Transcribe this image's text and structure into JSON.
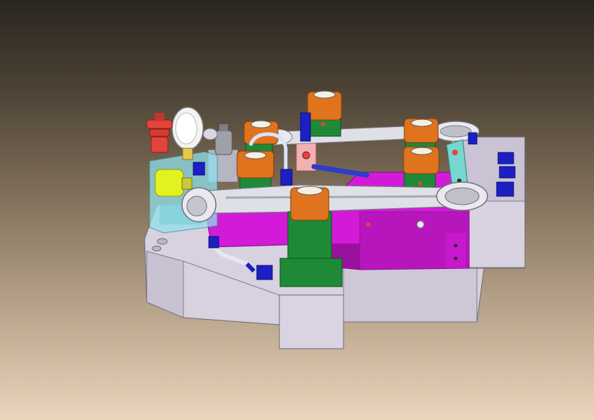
{
  "viewer": {
    "background_top": "#2a2520",
    "background_bottom": "#e9d6bd"
  },
  "model": {
    "colors": {
      "base": "#d7d1e0",
      "base_shadow": "#a9a3b4",
      "plate": "#d21ad8",
      "plate_dark": "#9b119f",
      "cylinder": "#1e8a37",
      "cylinder_dark": "#126424",
      "clamp": "#e0731e",
      "clamp_dark": "#a34e0f",
      "rod": "#dfe0e6",
      "rod_dark": "#9a9ca6",
      "fitting": "#1c1fc2",
      "fitting_dark": "#0c0e80",
      "manifold": "#8fe0ea",
      "valve": "#e2f221",
      "gauge": "#e8e8e8",
      "accent_red": "#e1443c",
      "block_grey": "#b4b6c2",
      "teal": "#76d6d0"
    }
  }
}
